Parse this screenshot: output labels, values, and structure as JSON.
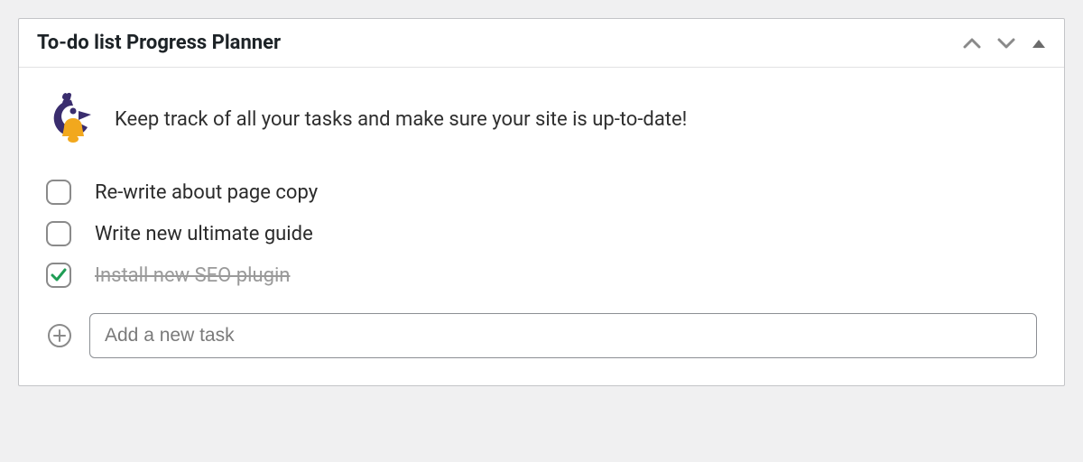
{
  "header": {
    "title": "To-do list Progress Planner"
  },
  "intro": {
    "text": "Keep track of all your tasks and make sure your site is up-to-date!"
  },
  "tasks": [
    {
      "label": "Re-write about page copy",
      "completed": false
    },
    {
      "label": "Write new ultimate guide",
      "completed": false
    },
    {
      "label": "Install new SEO plugin",
      "completed": true
    }
  ],
  "addTask": {
    "placeholder": "Add a new task"
  }
}
